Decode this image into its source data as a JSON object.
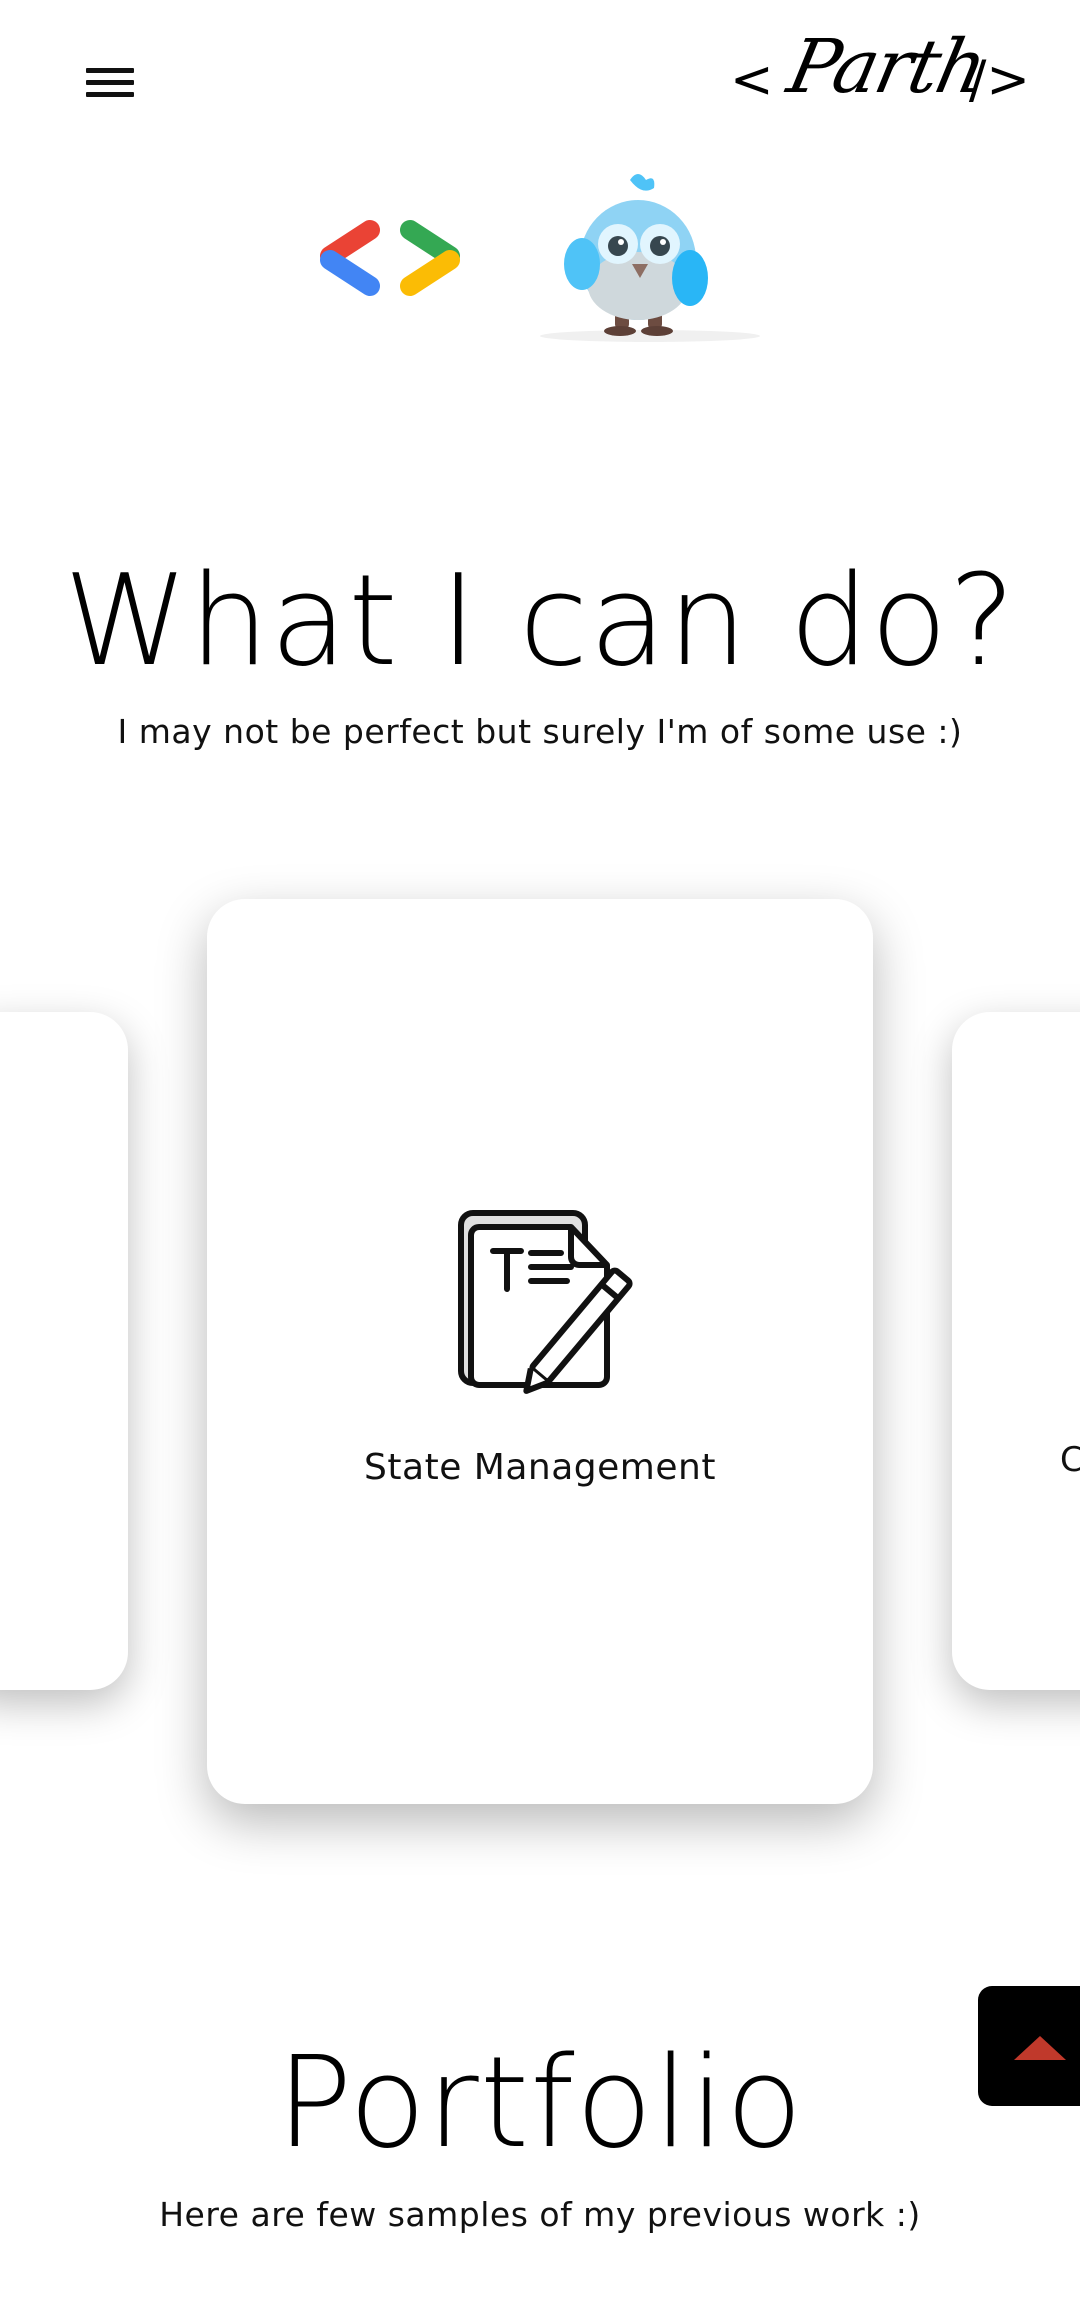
{
  "header": {
    "menu_icon": "hamburger-menu-icon",
    "signature": {
      "open": "<",
      "name": "Parth",
      "close": "/>"
    }
  },
  "hero": {
    "logo_icon": "google-developers-logo",
    "mascot_icon": "dash-bird-mascot"
  },
  "skills": {
    "title": "What I can do?",
    "subtitle": "I may not be perfect but surely I'm of some use :)",
    "center_card": {
      "icon": "document-edit-icon",
      "label": "State Management"
    },
    "right_card_peek": "C"
  },
  "portfolio": {
    "title": "Portfolio",
    "subtitle": "Here are few samples of my previous work :)"
  },
  "scroll_top": {
    "icon": "arrow-up-icon",
    "arrow_color": "#c0392b"
  },
  "colors": {
    "google_red": "#EA4335",
    "google_blue": "#4285F4",
    "google_green": "#34A853",
    "google_yellow": "#FBBC05",
    "mascot_blue": "#4FC3F7"
  }
}
